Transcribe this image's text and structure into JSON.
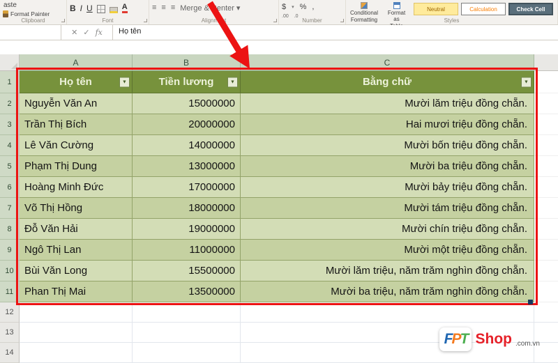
{
  "ribbon": {
    "paste_fragment": "aste",
    "format_painter": "Format Painter",
    "bold": "B",
    "italic": "I",
    "underline": "U",
    "font_color_letter": "A",
    "merge_center": "Merge & Center",
    "currency": "$",
    "percent": "%",
    "comma": ",",
    "increase_decimal": ".00",
    "decrease_decimal": ".0",
    "conditional_line1": "Conditional",
    "conditional_line2": "Formatting",
    "format_table_line1": "Format as",
    "format_table_line2": "Table",
    "style_chips": [
      "Neutral",
      "Calculation",
      "Check Cell"
    ],
    "group_labels": {
      "clipboard": "Clipboard",
      "font": "Font",
      "alignment": "Alignment",
      "number": "Number",
      "styles": "Styles"
    }
  },
  "formula_bar": {
    "name_box": "",
    "cancel": "✕",
    "enter": "✓",
    "fx": "fx",
    "content": "Họ tên"
  },
  "icons": {
    "dropdown": "▾",
    "filter": "▼",
    "align": "≡"
  },
  "sheet": {
    "column_letters": [
      "A",
      "B",
      "C"
    ],
    "row_numbers": [
      "1",
      "2",
      "3",
      "4",
      "5",
      "6",
      "7",
      "8",
      "9",
      "10",
      "11",
      "12",
      "13",
      "14"
    ],
    "table": {
      "headers": [
        "Họ tên",
        "Tiền lương",
        "Bằng chữ"
      ],
      "rows": [
        {
          "name": "Nguyễn Văn An",
          "salary": "15000000",
          "text": "Mười lăm triệu đồng chẵn."
        },
        {
          "name": "Trần Thị Bích",
          "salary": "20000000",
          "text": "Hai mươi triệu đồng chẵn."
        },
        {
          "name": "Lê Văn Cường",
          "salary": "14000000",
          "text": "Mười bốn triệu đồng chẵn."
        },
        {
          "name": "Phạm Thị Dung",
          "salary": "13000000",
          "text": "Mười ba triệu đồng chẵn."
        },
        {
          "name": "Hoàng Minh Đức",
          "salary": "17000000",
          "text": "Mười bảy triệu đồng chẵn."
        },
        {
          "name": "Võ Thị Hồng",
          "salary": "18000000",
          "text": "Mười tám triệu đồng chẵn."
        },
        {
          "name": "Đỗ Văn Hải",
          "salary": "19000000",
          "text": "Mười chín triệu đồng chẵn."
        },
        {
          "name": "Ngô Thị Lan",
          "salary": "11000000",
          "text": "Mười một triệu đồng chẵn."
        },
        {
          "name": "Bùi Văn Long",
          "salary": "15500000",
          "text": "Mười lăm triệu, năm trăm nghìn đồng chẵn."
        },
        {
          "name": "Phan Thị Mai",
          "salary": "13500000",
          "text": "Mười ba triệu, năm trăm nghìn đồng chẵn."
        }
      ]
    }
  },
  "watermark": {
    "f": "F",
    "p": "P",
    "t": "T",
    "shop": "Shop",
    "suffix": ".com.vn"
  },
  "colors": {
    "table_header_bg": "#77923C",
    "band_light": "#D3DDB6",
    "band_dark": "#C6D2A2",
    "annotation_red": "#EC1313",
    "neutral_bg": "#FFEB9C",
    "neutral_text": "#9C6500",
    "calculation_text": "#FA7D00",
    "check_cell_bg": "#5A6F7C"
  }
}
